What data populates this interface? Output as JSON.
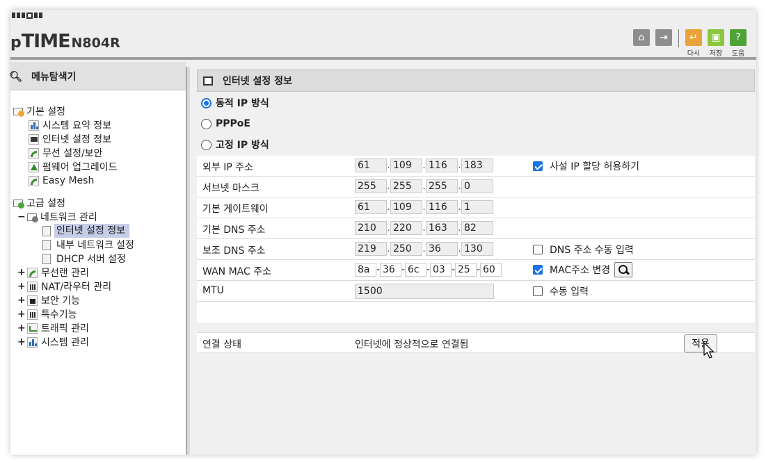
{
  "header": {
    "brand_prefix": "p",
    "brand_time": "TIME",
    "brand_model": "N804R",
    "buttons": [
      {
        "icon": "home-icon",
        "label": ""
      },
      {
        "icon": "logout-icon",
        "label": ""
      },
      {
        "icon": "restart-icon",
        "label": "다시"
      },
      {
        "icon": "save-icon",
        "label": "저장"
      },
      {
        "icon": "help-icon",
        "label": "도움"
      }
    ]
  },
  "sidebar": {
    "title": "메뉴탐색기",
    "basic": {
      "label": "기본 설정",
      "items": [
        "시스템 요약 정보",
        "인터넷 설정 정보",
        "무선 설정/보안",
        "펌웨어 업그레이드",
        "Easy Mesh"
      ]
    },
    "advanced": {
      "label": "고급 설정",
      "network": {
        "toggle": "−",
        "label": "네트워크 관리",
        "items": [
          "인터넷 설정 정보",
          "내부 네트워크 설정",
          "DHCP 서버 설정"
        ],
        "selected_index": 0
      },
      "groups": [
        {
          "toggle": "+",
          "label": "무선랜 관리"
        },
        {
          "toggle": "+",
          "label": "NAT/라우터 관리"
        },
        {
          "toggle": "+",
          "label": "보안 기능"
        },
        {
          "toggle": "+",
          "label": "특수기능"
        },
        {
          "toggle": "+",
          "label": "트래픽 관리"
        },
        {
          "toggle": "+",
          "label": "시스템 관리"
        }
      ]
    }
  },
  "main": {
    "title": "인터넷 설정 정보",
    "modes": [
      {
        "label": "동적 IP 방식",
        "selected": true
      },
      {
        "label": "PPPoE",
        "selected": false
      },
      {
        "label": "고정 IP 방식",
        "selected": false
      }
    ],
    "fields": {
      "wan_ip": {
        "label": "외부 IP 주소",
        "octets": [
          "61",
          "109",
          "116",
          "183"
        ],
        "option": {
          "label": "사설 IP 할당 허용하기",
          "checked": true
        }
      },
      "subnet": {
        "label": "서브넷 마스크",
        "octets": [
          "255",
          "255",
          "255",
          "0"
        ]
      },
      "gateway": {
        "label": "기본 게이트웨이",
        "octets": [
          "61",
          "109",
          "116",
          "1"
        ]
      },
      "dns1": {
        "label": "기본 DNS 주소",
        "octets": [
          "210",
          "220",
          "163",
          "82"
        ]
      },
      "dns2": {
        "label": "보조 DNS 주소",
        "octets": [
          "219",
          "250",
          "36",
          "130"
        ],
        "option": {
          "label": "DNS 주소 수동 입력",
          "checked": false
        }
      },
      "wan_mac": {
        "label": "WAN MAC 주소",
        "parts": [
          "8a",
          "36",
          "6c",
          "03",
          "25",
          "60"
        ],
        "option": {
          "label": "MAC주소 변경",
          "checked": true
        }
      },
      "mtu": {
        "label": "MTU",
        "value": "1500",
        "option": {
          "label": "수동 입력",
          "checked": false
        }
      }
    },
    "status": {
      "label": "연결 상태",
      "value": "인터넷에 정상적으로 연결됨"
    },
    "apply_label": "적용"
  },
  "colors": {
    "accent": "#1a73e8",
    "header_bg": "#eeeeee",
    "selected_bg": "#c6cde8"
  }
}
